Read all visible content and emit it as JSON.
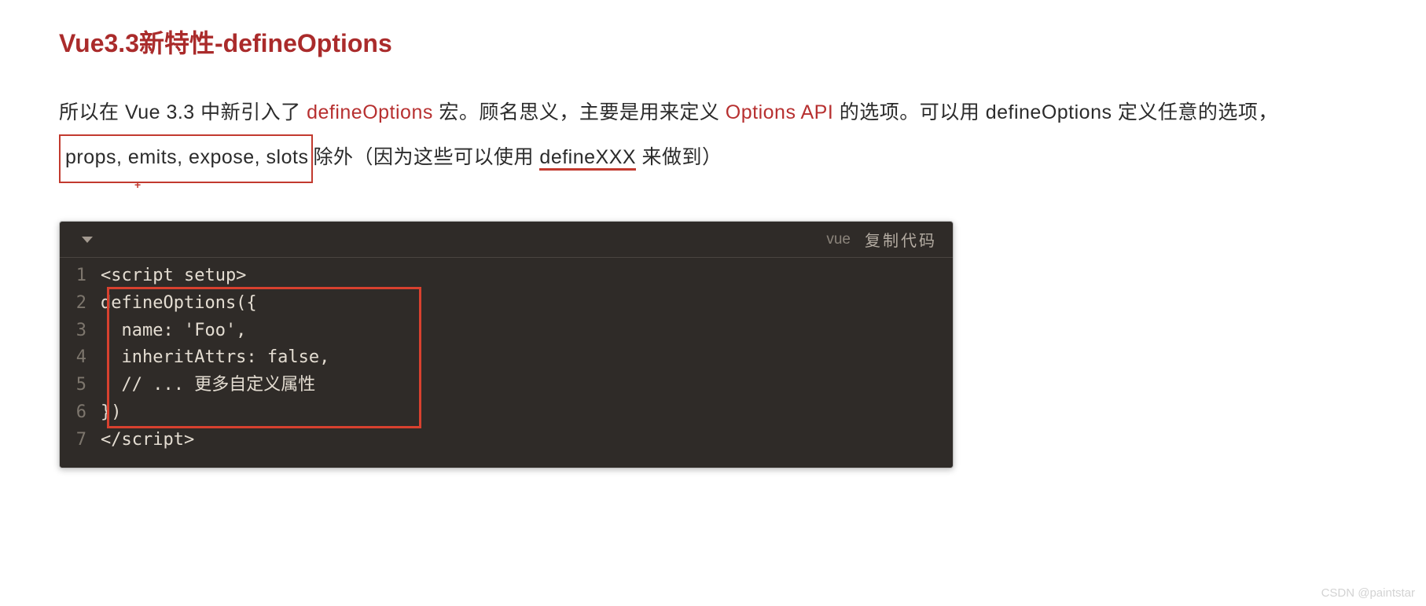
{
  "heading": "Vue3.3新特性-defineOptions",
  "paragraph": {
    "p1": "所以在 Vue 3.3 中新引入了 ",
    "hl1": "defineOptions",
    "p2": " 宏。顾名思义，主要是用来定义 ",
    "hl2": "Options API",
    "p3": " 的选项。可以用 defineOptions 定义任意的选项，",
    "boxed": " props, emits, expose, slots ",
    "plus": "+",
    "p4": "除外（因为这些可以使用 ",
    "underline": "defineXXX",
    "p5": " 来做到）"
  },
  "code": {
    "lang": "vue",
    "copy": "复制代码",
    "lines": [
      "<script setup>",
      "defineOptions({",
      "  name: 'Foo',",
      "  inheritAttrs: false,",
      "  // ... 更多自定义属性",
      "})",
      "</script>"
    ]
  },
  "watermark": "CSDN @paintstar"
}
